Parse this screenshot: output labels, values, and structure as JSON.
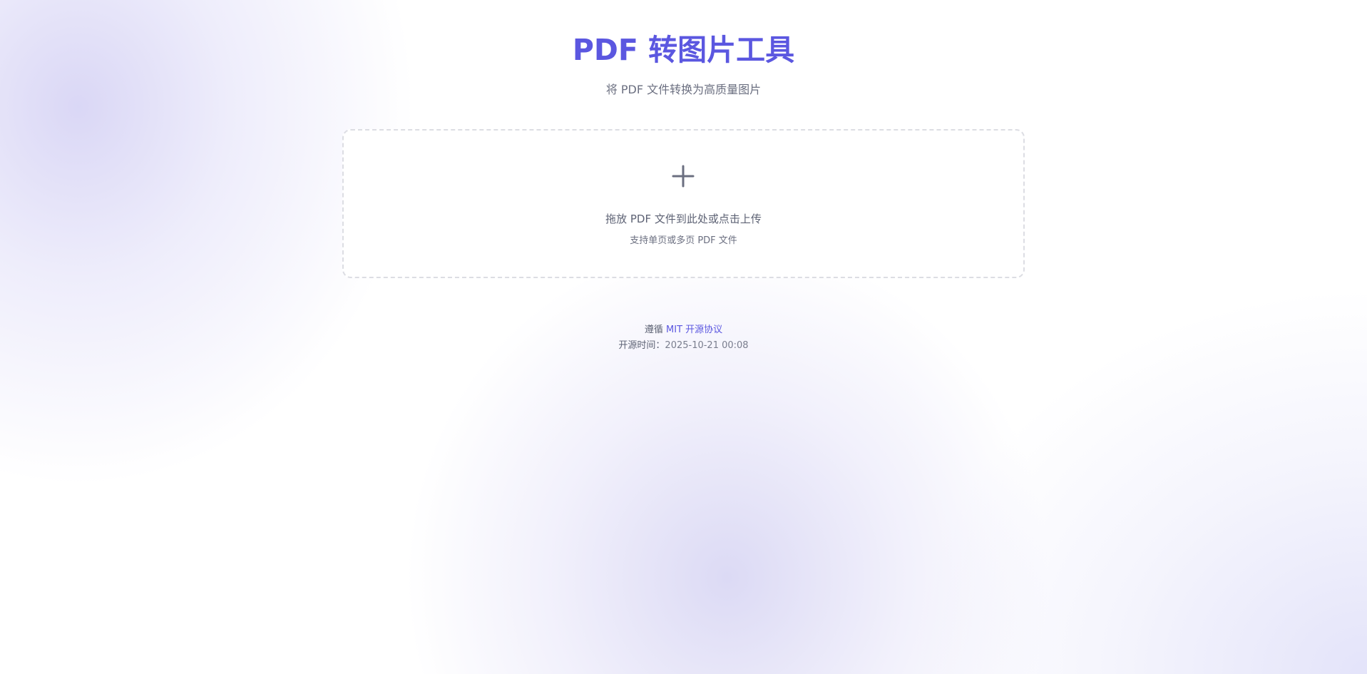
{
  "header": {
    "title": "PDF 转图片工具",
    "subtitle": "将 PDF 文件转换为高质量图片"
  },
  "upload": {
    "icon": "plus-icon",
    "main_text": "拖放 PDF 文件到此处或点击上传",
    "sub_text": "支持单页或多页 PDF 文件"
  },
  "footer": {
    "license_prefix": "遵循",
    "license_link": "MIT 开源协议",
    "time_label": "开源时间：",
    "time_value": "2025-10-21 00:08"
  },
  "colors": {
    "accent": "#5b57e0",
    "text": "#5d6274",
    "border": "#dcdde3"
  }
}
